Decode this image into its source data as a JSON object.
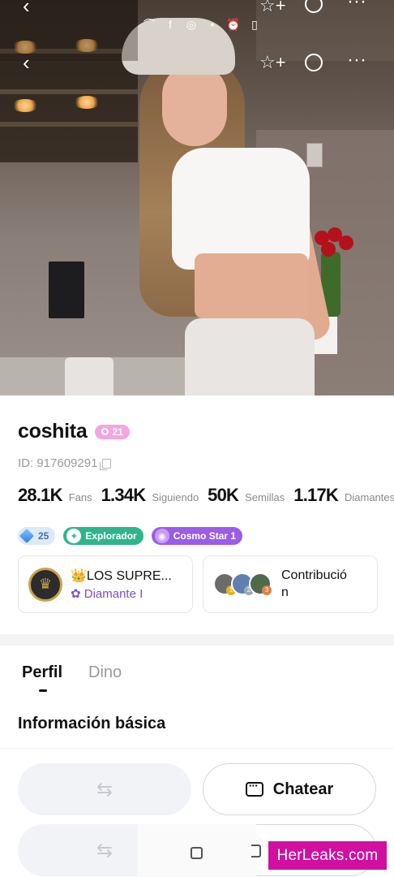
{
  "profile": {
    "username": "coshita",
    "level": "21",
    "id_text": "ID: 917609291"
  },
  "stats": [
    {
      "value": "28.1K",
      "label": "Fans"
    },
    {
      "value": "1.34K",
      "label": "Siguiendo"
    },
    {
      "value": "50K",
      "label": "Semillas"
    },
    {
      "value": "1.17K",
      "label": "Diamantes"
    }
  ],
  "badges": {
    "diamond_level": "25",
    "explorer": "Explorador",
    "cosmo": "Cosmo Star 1"
  },
  "family_card": {
    "title": "👑LOS SUPRE...",
    "rank": "Diamante I"
  },
  "contribution_card": {
    "title": "Contribució n",
    "line1": "Contribució",
    "line2": "n",
    "ranks": [
      "1",
      "2",
      "3"
    ]
  },
  "tabs": [
    {
      "label": "Perfil",
      "active": true
    },
    {
      "label": "Dino",
      "active": false
    }
  ],
  "section_title": "Información básica",
  "actions": {
    "follow_icon": "⇆",
    "chat_label": "Chatear"
  },
  "watermark": "HerLeaks.com",
  "colors": {
    "level_badge": "#f3a6e0",
    "explorer_badge": "#2fb58c",
    "cosmo_badge": "#9b5de5",
    "family_rank_text": "#7b4fc4",
    "watermark_bg": "#d10fa0"
  }
}
